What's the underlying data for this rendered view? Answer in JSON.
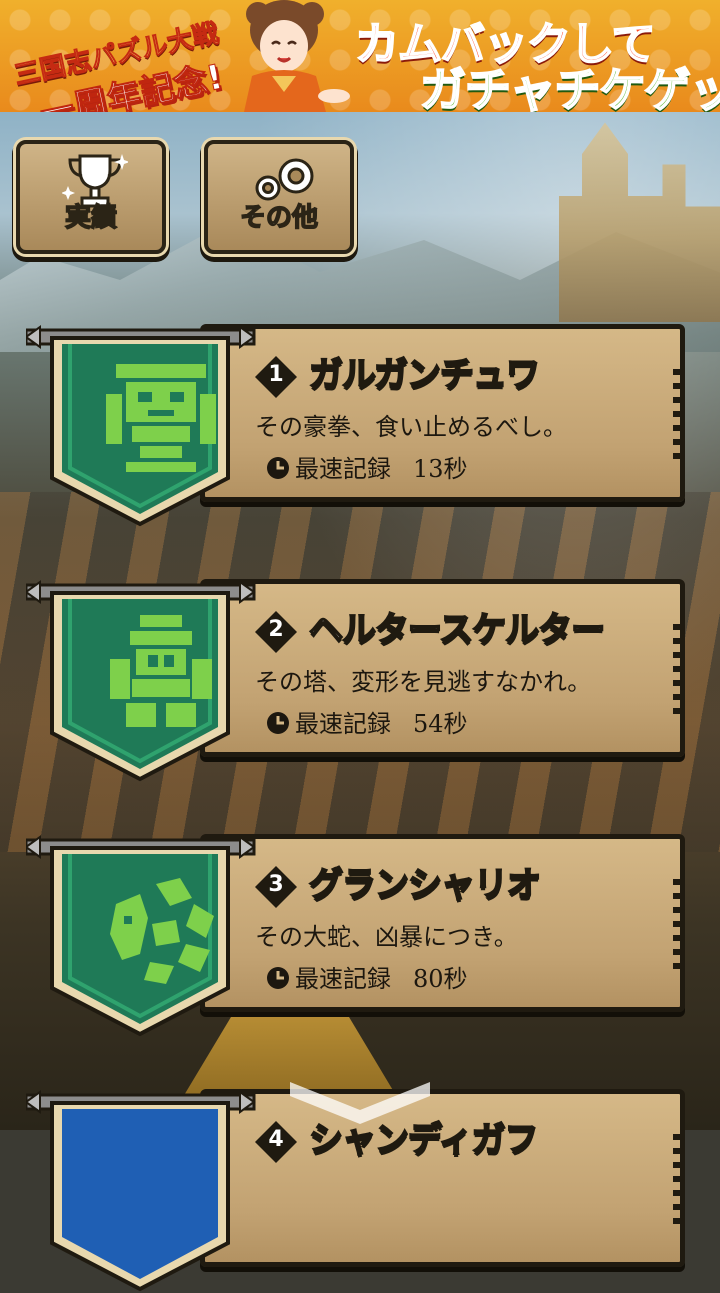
{
  "banner": {
    "left_line1": "三国志パズル大戦",
    "left_line2": "一周年記念!",
    "right_line1": "カムバックして",
    "right_line2": "ガチャチケゲット!"
  },
  "buttons": {
    "achievements": "実績",
    "other": "その他"
  },
  "bosses": [
    {
      "number": "1",
      "name": "ガルガンチュワ",
      "description": "その豪拳、食い止めるべし。",
      "record_label": "最速記録",
      "record_value": "13秒",
      "color": "#1f7a57"
    },
    {
      "number": "2",
      "name": "ヘルタースケルター",
      "description": "その塔、変形を見逃すなかれ。",
      "record_label": "最速記録",
      "record_value": "54秒",
      "color": "#1f7a57"
    },
    {
      "number": "3",
      "name": "グランシャリオ",
      "description": "その大蛇、凶暴につき。",
      "record_label": "最速記録",
      "record_value": "80秒",
      "color": "#1f7a57"
    },
    {
      "number": "4",
      "name": "シャンディガフ",
      "color": "#1f5fb4"
    }
  ],
  "colors": {
    "banner_orange": "#f0b02c",
    "card_tan": "#c9aa79",
    "emblem_green": "#7ed04b"
  }
}
